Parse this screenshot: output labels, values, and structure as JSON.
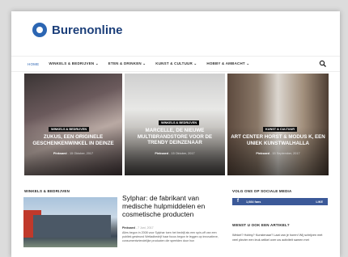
{
  "header": {
    "logo_text": "Burenonline"
  },
  "nav": {
    "items": [
      {
        "label": "HOME",
        "active": true
      },
      {
        "label": "WINKELS & BEDRIJVEN ⌄",
        "active": false
      },
      {
        "label": "ETEN & DRINKEN ⌄",
        "active": false
      },
      {
        "label": "KUNST & CULTUUR ⌄",
        "active": false
      },
      {
        "label": "HOBBY & AMBACHT ⌄",
        "active": false
      }
    ]
  },
  "tiles": [
    {
      "badge": "WINKELS & BEDRIJVEN",
      "title": "ZUKUS, EEN ORIGINELE GESCHENKENWINKEL IN DEINZE",
      "author": "Pinksaed",
      "date": "15 Oktober, 2017"
    },
    {
      "badge": "WINKELS & BEDRIJVEN",
      "title": "MARCELLE, DE NIEUWE MULTIBRANDSTORE VOOR DE TRENDY DEINZENAAR",
      "author": "Pinksaed",
      "date": "15 Oktober, 2017"
    },
    {
      "badge": "KUNST & CULTUUR",
      "title": "ART CENTER HORST & MODUS K, EEN UNIEK KUNSTWALHALLA",
      "author": "Pinksaed",
      "date": "15 September, 2017"
    }
  ],
  "left_section": {
    "title": "WINKELS & BEDRIJVEN",
    "article": {
      "title": "Sylphar: de fabrikant van medische hulpmiddelen en cosmetische producten",
      "author": "Pinksaed",
      "date": "7 Juni, 2017",
      "excerpt": "Alles begon in 2008 voor Sylphar toen het bedrijf als een spin-off van een publiek gesteund Wetladbedrijf haar focus begon te leggen op innovatieve, consumentvriendelijke producten die speelden door hun"
    }
  },
  "right_section": {
    "social_title": "VOLG ONS OP SOCIALE MEDIA",
    "facebook": {
      "icon": "f",
      "count": "1,084 fans",
      "action": "LIKE"
    },
    "promo_title": "WENST U OOK EEN ARTIKEL?",
    "promo_text": "Winkel? Hobby? Kunstenaar? Laat van je horen! Wij schrijven met veel plezier een leuk artikel over uw activiteit samen met"
  },
  "colors": {
    "brand": "#2c66b3",
    "facebook": "#3b5998"
  }
}
